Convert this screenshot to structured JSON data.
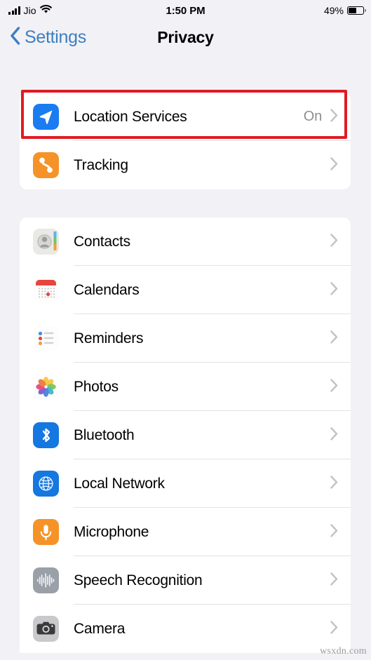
{
  "status_bar": {
    "carrier": "Jio",
    "signal_icon": "signal-bars-icon",
    "wifi_icon": "wifi-icon",
    "time": "1:50 PM",
    "battery_percent": "49%",
    "battery_icon": "battery-icon",
    "battery_level": 49
  },
  "nav": {
    "back_label": "Settings",
    "back_icon": "chevron-left-icon",
    "title": "Privacy"
  },
  "highlight": {
    "color": "#e01b22",
    "target": "Location Services"
  },
  "groups": [
    {
      "id": "primary",
      "rows": [
        {
          "label": "Location Services",
          "value": "On",
          "icon": "location-arrow-icon",
          "icon_color": "#1a7cf0"
        },
        {
          "label": "Tracking",
          "value": "",
          "icon": "tracking-icon",
          "icon_color": "#f59328"
        }
      ]
    },
    {
      "id": "secondary",
      "rows": [
        {
          "label": "Contacts",
          "value": "",
          "icon": "contacts-icon",
          "icon_color": "#cfcfcc"
        },
        {
          "label": "Calendars",
          "value": "",
          "icon": "calendar-icon",
          "icon_color": "#ffffff"
        },
        {
          "label": "Reminders",
          "value": "",
          "icon": "reminders-icon",
          "icon_color": "#ffffff"
        },
        {
          "label": "Photos",
          "value": "",
          "icon": "photos-icon",
          "icon_color": "#ffffff"
        },
        {
          "label": "Bluetooth",
          "value": "",
          "icon": "bluetooth-icon",
          "icon_color": "#1577e0"
        },
        {
          "label": "Local Network",
          "value": "",
          "icon": "globe-icon",
          "icon_color": "#1577e0"
        },
        {
          "label": "Microphone",
          "value": "",
          "icon": "microphone-icon",
          "icon_color": "#f59328"
        },
        {
          "label": "Speech Recognition",
          "value": "",
          "icon": "waveform-icon",
          "icon_color": "#9aa0a8"
        },
        {
          "label": "Camera",
          "value": "",
          "icon": "camera-icon",
          "icon_color": "#6e6e73"
        }
      ]
    }
  ],
  "chevron_label": ">",
  "watermark": "wsxdn.com"
}
